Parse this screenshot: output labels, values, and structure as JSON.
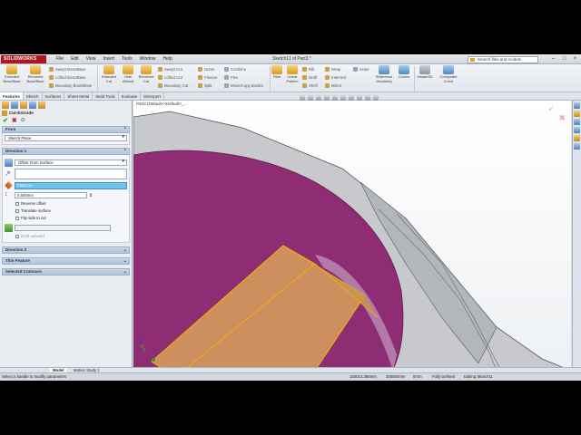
{
  "app": {
    "logo": "SOLIDWORKS",
    "title": "Sketch11 of Part3 *"
  },
  "menu": [
    "File",
    "Edit",
    "View",
    "Insert",
    "Tools",
    "Window",
    "Help"
  ],
  "search": {
    "placeholder": "Search files and models"
  },
  "commands": {
    "extruded_boss": "Extruded Boss/Base",
    "revolved_boss": "Revolved Boss/Base",
    "swept_boss": "Swept Boss/Base",
    "lofted_boss": "Lofted Boss/Base",
    "boundary_boss": "Boundary Boss/Base",
    "extruded_cut": "Extruded Cut",
    "hole_wizard": "Hole Wizard",
    "revolved_cut": "Revolved Cut",
    "swept_cut": "Swept Cut",
    "lofted_cut": "Lofted Cut",
    "boundary_cut": "Boundary Cut",
    "dome": "Dome",
    "flexure": "Flexure",
    "split": "Split",
    "combine": "Combine",
    "flex": "Flex",
    "move_copy": "Move/Copy Bodies",
    "fillet": "Fillet",
    "linear_pattern": "Linear Pattern",
    "rib": "Rib",
    "draft": "Draft",
    "shell": "Shell",
    "wrap": "Wrap",
    "intersect": "Intersect",
    "mirror": "Mirror",
    "scale": "Scale",
    "reference_geometry": "Reference Geometry",
    "curves": "Curves",
    "instant3d": "Instant3D",
    "composite_curve": "Composite Curve"
  },
  "tabs": [
    "Features",
    "Sketch",
    "Surfaces",
    "Sheet Metal",
    "Mold Tools",
    "Evaluate",
    "DimXpert"
  ],
  "panel": {
    "feature_title": "Cut-Extrude",
    "from_header": "From",
    "from_value": "Sketch Plane",
    "direction1_header": "Direction 1",
    "end_condition": "Offset From Surface",
    "direction_value": "",
    "face_value": "Face<1>",
    "offset_value": "0.500mm",
    "reverse_offset": "Reverse offset",
    "translate_surface": "Translate surface",
    "flip_side": "Flip side to cut",
    "draft_outward": "Draft outward",
    "direction2_header": "Direction 2",
    "thin_feature_header": "Thin Feature",
    "selected_contours_header": "Selected Contours"
  },
  "viewport": {
    "breadcrumb": "Part3 (Default<<Default>_..."
  },
  "bottom_tabs": {
    "model": "Model",
    "motion": "Motion Study 1"
  },
  "status": {
    "hint": "Select a handle to modify parameters",
    "x": "150013.398mm",
    "y": "300000mm",
    "z": "0mm",
    "state": "Fully Defined",
    "editing": "Editing Sketch11"
  },
  "colors": {
    "body_grey": "#c7c9cd",
    "face_magenta": "#8e2d74",
    "cut_orange": "#d9a15a",
    "selection": "#6ec3ee"
  }
}
